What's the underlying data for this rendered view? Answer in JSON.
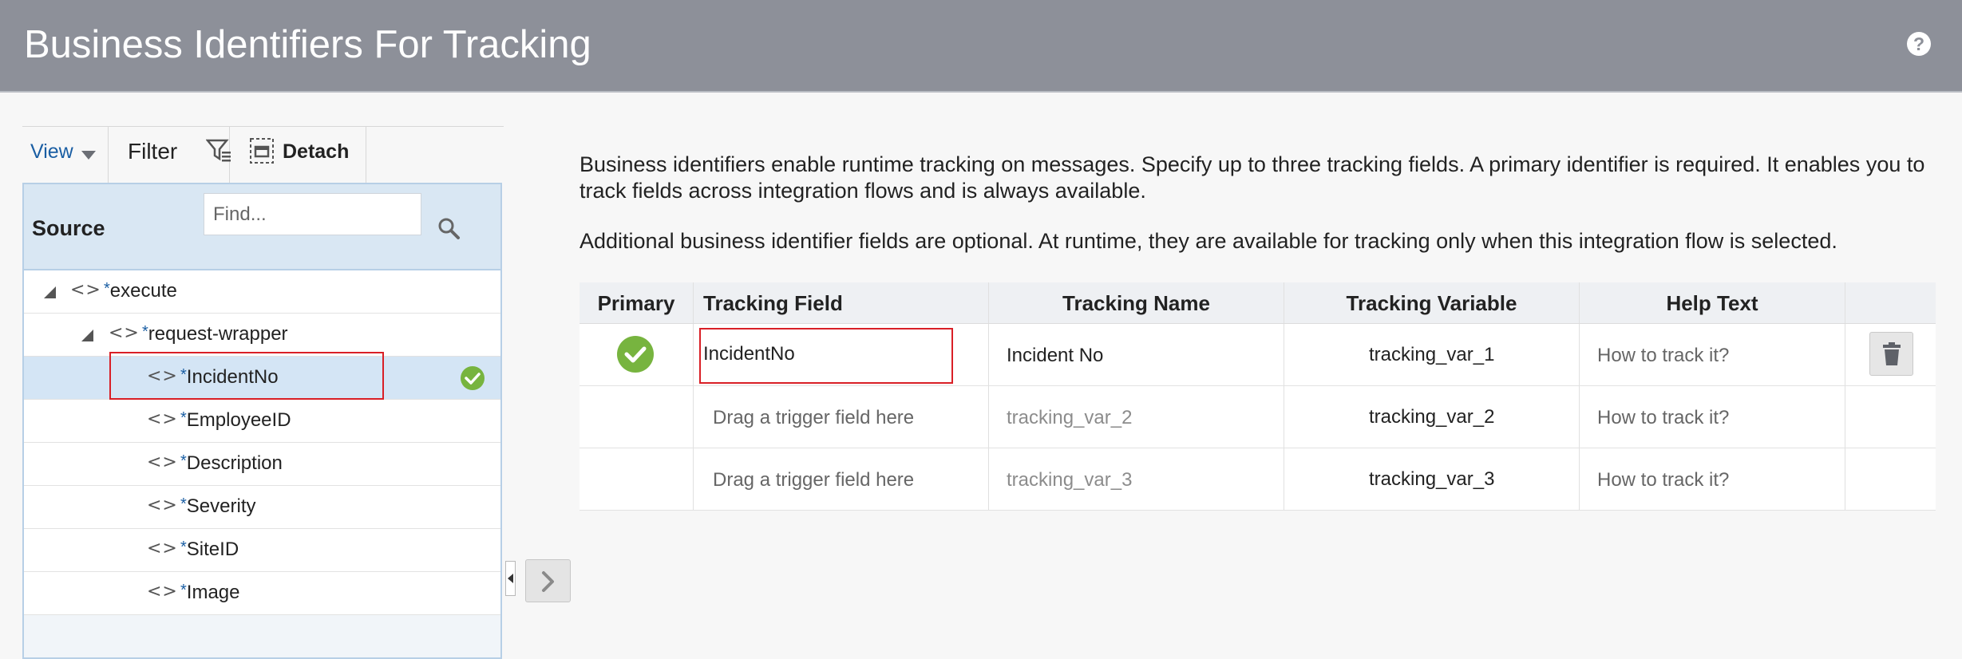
{
  "header": {
    "title": "Business Identifiers For Tracking",
    "help_symbol": "?"
  },
  "toolbar": {
    "view_label": "View",
    "filter_label": "Filter",
    "detach_label": "Detach"
  },
  "source_panel": {
    "title": "Source",
    "find_placeholder": "Find...",
    "required_marker": "*",
    "tree": [
      {
        "label": "execute",
        "level": 0,
        "expanded": true
      },
      {
        "label": "request-wrapper",
        "level": 1,
        "expanded": true
      },
      {
        "label": "IncidentNo",
        "level": 2,
        "selected": true,
        "tracked": true
      },
      {
        "label": "EmployeeID",
        "level": 2
      },
      {
        "label": "Description",
        "level": 2
      },
      {
        "label": "Severity",
        "level": 2
      },
      {
        "label": "SiteID",
        "level": 2
      },
      {
        "label": "Image",
        "level": 2
      }
    ]
  },
  "description": {
    "paragraph_1": "Business identifiers enable runtime tracking on messages. Specify up to three tracking fields. A primary identifier is required. It enables you to track fields across integration flows and is always available.",
    "paragraph_2": "Additional business identifier fields are optional. At runtime, they are available for tracking only when this integration flow is selected."
  },
  "tracking_table": {
    "columns": [
      "Primary",
      "Tracking Field",
      "Tracking Name",
      "Tracking Variable",
      "Help Text",
      ""
    ],
    "rows": [
      {
        "primary": true,
        "tracking_field": "IncidentNo",
        "tracking_name": "Incident No",
        "tracking_variable": "tracking_var_1",
        "help_text": "How to track it?",
        "has_delete": true
      },
      {
        "primary": false,
        "tracking_field": "Drag a trigger field here",
        "tracking_name": "tracking_var_2",
        "tracking_variable": "tracking_var_2",
        "help_text": "How to track it?",
        "has_delete": false
      },
      {
        "primary": false,
        "tracking_field": "Drag a trigger field here",
        "tracking_name": "tracking_var_3",
        "tracking_variable": "tracking_var_3",
        "help_text": "How to track it?",
        "has_delete": false
      }
    ]
  },
  "icons": {
    "help": "help-circle-icon",
    "view_caret": "caret-down-icon",
    "filter": "filter-icon",
    "detach": "detach-icon",
    "search": "search-icon",
    "tree_expander": "expand-triangle-icon",
    "element": "element-code-icon",
    "check": "check-circle-icon",
    "collapse_panel": "collapse-left-icon",
    "move": "chevron-right-icon",
    "delete": "trash-icon"
  },
  "colors": {
    "header_bg": "#8d9099",
    "accent_blue": "#1a5ea3",
    "success_green": "#77b43f",
    "selection_bg": "#d4e5f5",
    "highlight_red": "#d91f26"
  }
}
